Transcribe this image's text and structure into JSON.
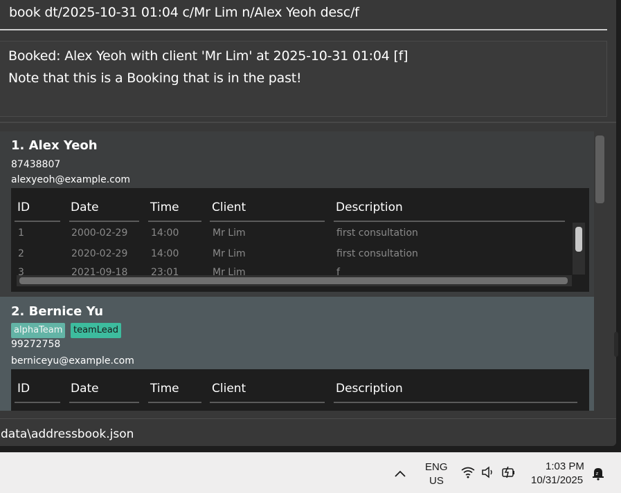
{
  "command_box": {
    "text": "book dt/2025-10-31 01:04 c/Mr Lim n/Alex Yeoh desc/f"
  },
  "result_box": {
    "line1": "Booked: Alex Yeoh with client 'Mr Lim' at 2025-10-31 01:04 [f]",
    "line2": "Note that this is a Booking that is in the past!"
  },
  "persons": [
    {
      "title": "1. Alex Yeoh",
      "phone": "87438807",
      "email": "alexyeoh@example.com",
      "tags": [],
      "bookings": [
        {
          "id": "1",
          "date": "2000-02-29",
          "time": "14:00",
          "client": "Mr Lim",
          "description": "first consultation"
        },
        {
          "id": "2",
          "date": "2020-02-29",
          "time": "14:00",
          "client": "Mr Lim",
          "description": "first consultation"
        },
        {
          "id": "3",
          "date": "2021-09-18",
          "time": "23:01",
          "client": "Mr Lim",
          "description": "f"
        }
      ]
    },
    {
      "title": "2. Bernice Yu",
      "phone": "99272758",
      "email": "berniceyu@example.com",
      "tags": [
        "alphaTeam",
        "teamLead"
      ],
      "bookings": []
    }
  ],
  "table_headers": {
    "id": "ID",
    "date": "Date",
    "time": "Time",
    "client": "Client",
    "description": "Description"
  },
  "status_bar": {
    "path": "data\\addressbook.json"
  },
  "taskbar": {
    "show_hidden_icon": "chevron-up-icon",
    "language_line1": "ENG",
    "language_line2": "US",
    "time": "1:03 PM",
    "date": "10/31/2025",
    "icons": [
      "wifi-icon",
      "speaker-icon",
      "battery-icon",
      "notification-bell-icon"
    ]
  },
  "colors": {
    "tag_alpha": "#63b4a6",
    "tag_lead": "#3dbc9e",
    "selected_card": "#505a5e",
    "window_bg": "#383838"
  }
}
